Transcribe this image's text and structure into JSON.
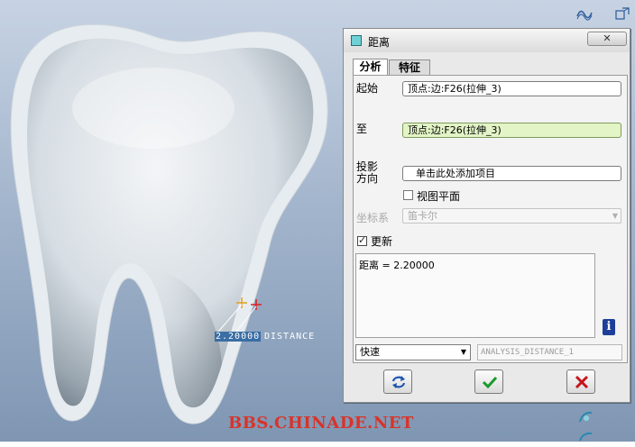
{
  "viewport": {
    "dimension_value": "2.20000",
    "dimension_label": "DISTANCE",
    "watermark": "BBS.CHINADE.NET"
  },
  "dialog": {
    "title": "距离",
    "close_label": "✕",
    "tabs": [
      {
        "label": "分析",
        "active": true
      },
      {
        "label": "特征",
        "active": false
      }
    ],
    "from_label": "起始",
    "from_value": "顶点:边:F26(拉伸_3)",
    "to_label": "至",
    "to_value": "顶点:边:F26(拉伸_3)",
    "projection_label": "投影方向",
    "projection_value": "单击此处添加项目",
    "view_plane_label": "视图平面",
    "view_plane_checked": false,
    "coord_label": "坐标系",
    "coord_value": "笛卡尔",
    "update_label": "更新",
    "update_checked": true,
    "result_text": "距离  =  2.20000",
    "info_icon": "i",
    "speed_value": "快速",
    "analysis_name": "ANALYSIS_DISTANCE_1",
    "buttons": {
      "repeat": "repeat-icon",
      "ok": "check-icon",
      "cancel": "x-icon"
    }
  },
  "colors": {
    "ok_green": "#1a9a2a",
    "cancel_red": "#c4161c",
    "to_field_bg": "#e3f4c6",
    "viewport_top": "#c7d3e3",
    "viewport_bottom": "#7f96b3"
  }
}
